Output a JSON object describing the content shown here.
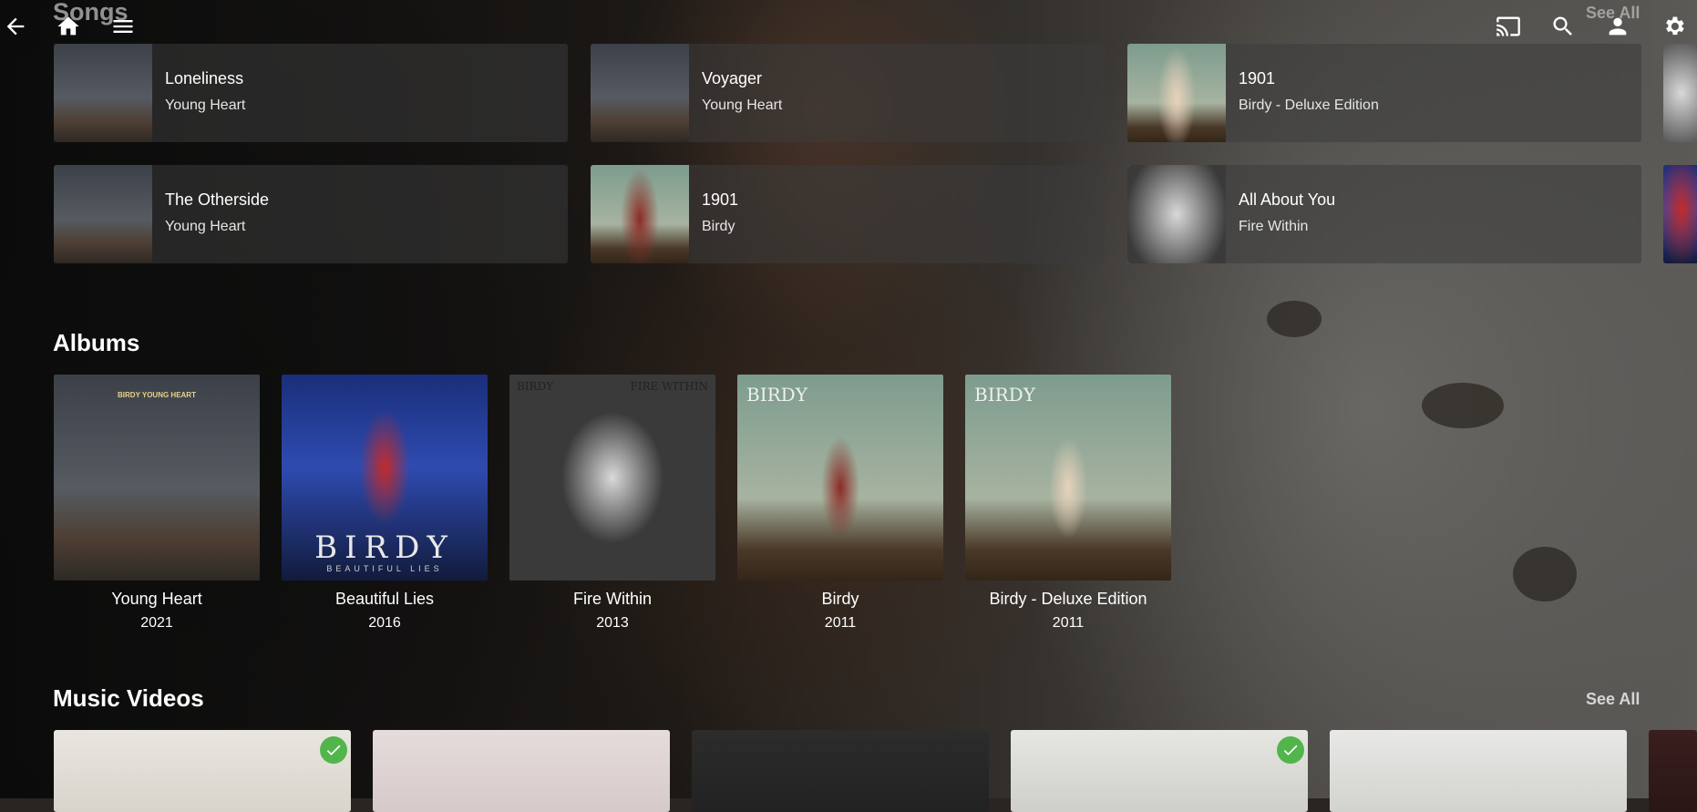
{
  "header": {
    "icons": [
      "back-arrow-icon",
      "home-icon",
      "menu-icon",
      "cast-icon",
      "search-icon",
      "user-icon",
      "gear-icon"
    ]
  },
  "songs": {
    "title": "Songs",
    "see_all": "See All",
    "items": [
      {
        "title": "Loneliness",
        "album": "Young Heart"
      },
      {
        "title": "Voyager",
        "album": "Young Heart"
      },
      {
        "title": "1901",
        "album": "Birdy - Deluxe Edition"
      },
      {
        "title": "The Otherside",
        "album": "Young Heart"
      },
      {
        "title": "1901",
        "album": "Birdy"
      },
      {
        "title": "All About You",
        "album": "Fire Within"
      }
    ]
  },
  "albums": {
    "title": "Albums",
    "items": [
      {
        "name": "Young Heart",
        "year": "2021",
        "cover_text": "BIRDY YOUNG HEART"
      },
      {
        "name": "Beautiful Lies",
        "year": "2016",
        "cover_text": "BIRDY",
        "cover_sub": "BEAUTIFUL LIES"
      },
      {
        "name": "Fire Within",
        "year": "2013",
        "cover_left": "BIRDY",
        "cover_right": "FIRE WITHIN"
      },
      {
        "name": "Birdy",
        "year": "2011",
        "cover_text": "BIRDY"
      },
      {
        "name": "Birdy - Deluxe Edition",
        "year": "2011",
        "cover_text": "BIRDY"
      }
    ]
  },
  "music_videos": {
    "title": "Music Videos",
    "see_all": "See All",
    "watched": [
      true,
      false,
      false,
      true,
      false
    ]
  },
  "colors": {
    "played_check": "#52b54b",
    "card_bg": "rgba(60,60,60,0.55)"
  }
}
